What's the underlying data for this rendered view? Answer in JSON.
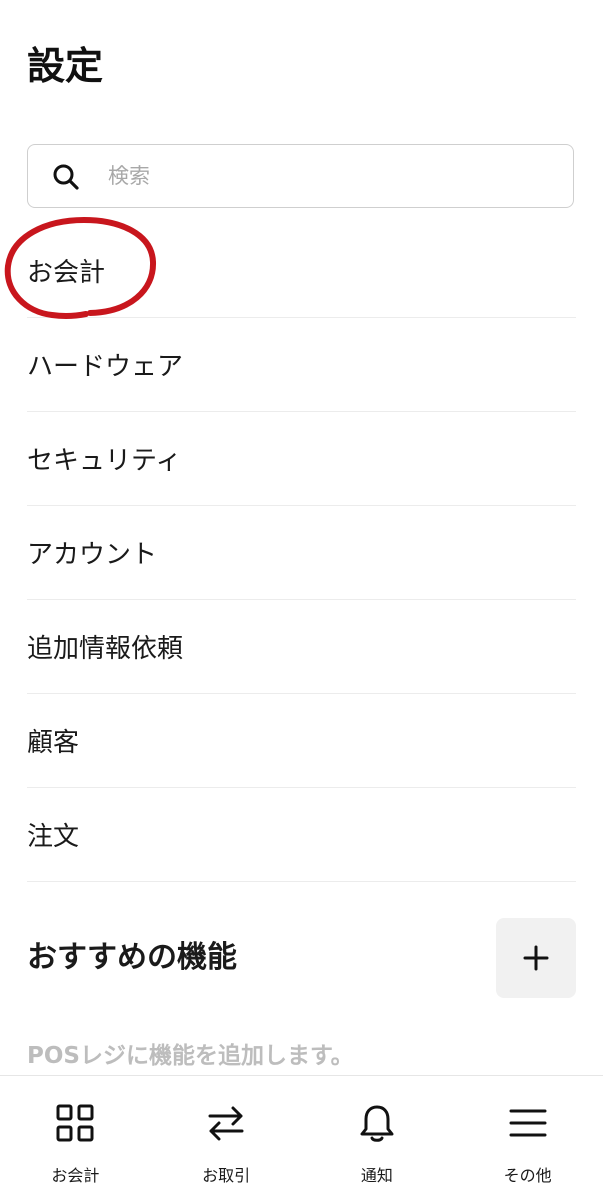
{
  "header": {
    "title": "設定"
  },
  "search": {
    "placeholder": "検索",
    "value": ""
  },
  "settings": {
    "items": [
      {
        "label": "お会計",
        "highlighted": true
      },
      {
        "label": "ハードウェア"
      },
      {
        "label": "セキュリティ"
      },
      {
        "label": "アカウント"
      },
      {
        "label": "追加情報依頼"
      },
      {
        "label": "顧客"
      },
      {
        "label": "注文"
      }
    ]
  },
  "features": {
    "title": "おすすめの機能",
    "description": "POSレジに機能を追加します。",
    "add_icon": "plus-icon"
  },
  "bottom_nav": {
    "items": [
      {
        "label": "お会計",
        "icon": "grid-icon"
      },
      {
        "label": "お取引",
        "icon": "transfer-arrows-icon"
      },
      {
        "label": "通知",
        "icon": "bell-icon"
      },
      {
        "label": "その他",
        "icon": "menu-icon"
      }
    ]
  },
  "colors": {
    "highlight": "#c8161d",
    "divider": "#ececec",
    "muted_text": "#bdbdbd",
    "button_background": "#f1f1f1"
  }
}
